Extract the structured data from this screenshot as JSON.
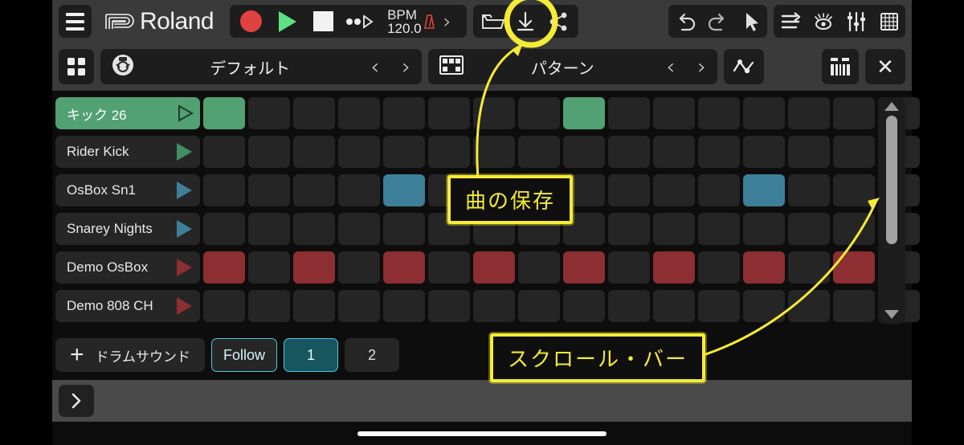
{
  "app": {
    "brand": "Roland",
    "brand_mark": "roland-logo-mark"
  },
  "toolbar_top": {
    "menu_label": "hamburger-menu",
    "transport": {
      "record_label": "record",
      "play_label": "play",
      "stop_label": "stop",
      "skip_label": "skip-forward"
    },
    "bpm": {
      "label": "BPM",
      "value": "120.0",
      "metronome_icon": "metronome-icon",
      "next_label": "›"
    },
    "file": {
      "open_label": "open-folder-icon",
      "save_label": "save-download-icon",
      "share_label": "share-icon"
    },
    "edit": {
      "undo_label": "undo-icon",
      "redo_label": "redo-icon",
      "select_label": "pointer-icon"
    },
    "view": {
      "arrange_label": "arrange-icon",
      "eye_label": "eye-icon",
      "mixer_label": "mixer-faders-icon",
      "pads_label": "pad-grid-icon"
    }
  },
  "toolbar_second": {
    "apps_label": "apps-grid-icon",
    "kit": {
      "icon": "drum-kit-icon",
      "name": "デフォルト",
      "prev_label": "‹",
      "next_label": "›"
    },
    "pattern": {
      "icon": "pattern-grid-icon",
      "name": "パターン",
      "prev_label": "‹",
      "next_label": "›"
    },
    "automation_label": "automation-curve-icon",
    "keyboard_label": "keyboard-icon",
    "close_label": "✕"
  },
  "sequencer": {
    "steps": 16,
    "tracks": [
      {
        "name": "キック 26",
        "color": "#51a173",
        "selected": true,
        "steps": [
          1,
          0,
          0,
          0,
          0,
          0,
          0,
          0,
          1,
          0,
          0,
          0,
          0,
          0,
          0,
          0
        ]
      },
      {
        "name": "Rider Kick",
        "color": "#3f8f62",
        "selected": false,
        "steps": [
          0,
          0,
          0,
          0,
          0,
          0,
          0,
          0,
          0,
          0,
          0,
          0,
          0,
          0,
          0,
          0
        ]
      },
      {
        "name": "OsBox Sn1",
        "color": "#3d7f99",
        "selected": false,
        "steps": [
          0,
          0,
          0,
          0,
          1,
          0,
          0,
          0,
          0,
          0,
          0,
          0,
          1,
          0,
          0,
          0
        ]
      },
      {
        "name": "Snarey Nights",
        "color": "#3d7f99",
        "selected": false,
        "steps": [
          0,
          0,
          0,
          0,
          0,
          0,
          0,
          0,
          0,
          0,
          0,
          0,
          0,
          0,
          0,
          0
        ]
      },
      {
        "name": "Demo OsBox",
        "color": "#8c2e32",
        "selected": false,
        "steps": [
          1,
          0,
          1,
          0,
          1,
          0,
          1,
          0,
          1,
          0,
          1,
          0,
          1,
          0,
          1,
          0
        ]
      },
      {
        "name": "Demo 808 CH",
        "color": "#8c2e32",
        "selected": false,
        "steps": [
          0,
          0,
          0,
          0,
          0,
          0,
          0,
          0,
          0,
          0,
          0,
          0,
          0,
          0,
          0,
          0
        ]
      }
    ],
    "scrollbar": {
      "up_label": "scroll-up-arrow",
      "down_label": "scroll-down-arrow",
      "thumb_label": "scroll-thumb"
    }
  },
  "bottom_controls": {
    "add_sound": {
      "plus": "+",
      "label": "ドラムサウンド"
    },
    "follow_label": "Follow",
    "pages": [
      {
        "label": "1",
        "active": true
      },
      {
        "label": "2",
        "active": false
      }
    ],
    "expand_label": "›"
  },
  "annotations": [
    {
      "id": "save-song",
      "text": "曲の保存",
      "color": "#f5ec35"
    },
    {
      "id": "scroll-bar",
      "text": "スクロール・バー",
      "color": "#f5ec35"
    }
  ],
  "colors": {
    "accent_green": "#51a173",
    "accent_blue": "#3d7f99",
    "accent_red": "#8c2e32",
    "annotation_yellow": "#f5ec35",
    "cyan": "#4fc8e0"
  }
}
